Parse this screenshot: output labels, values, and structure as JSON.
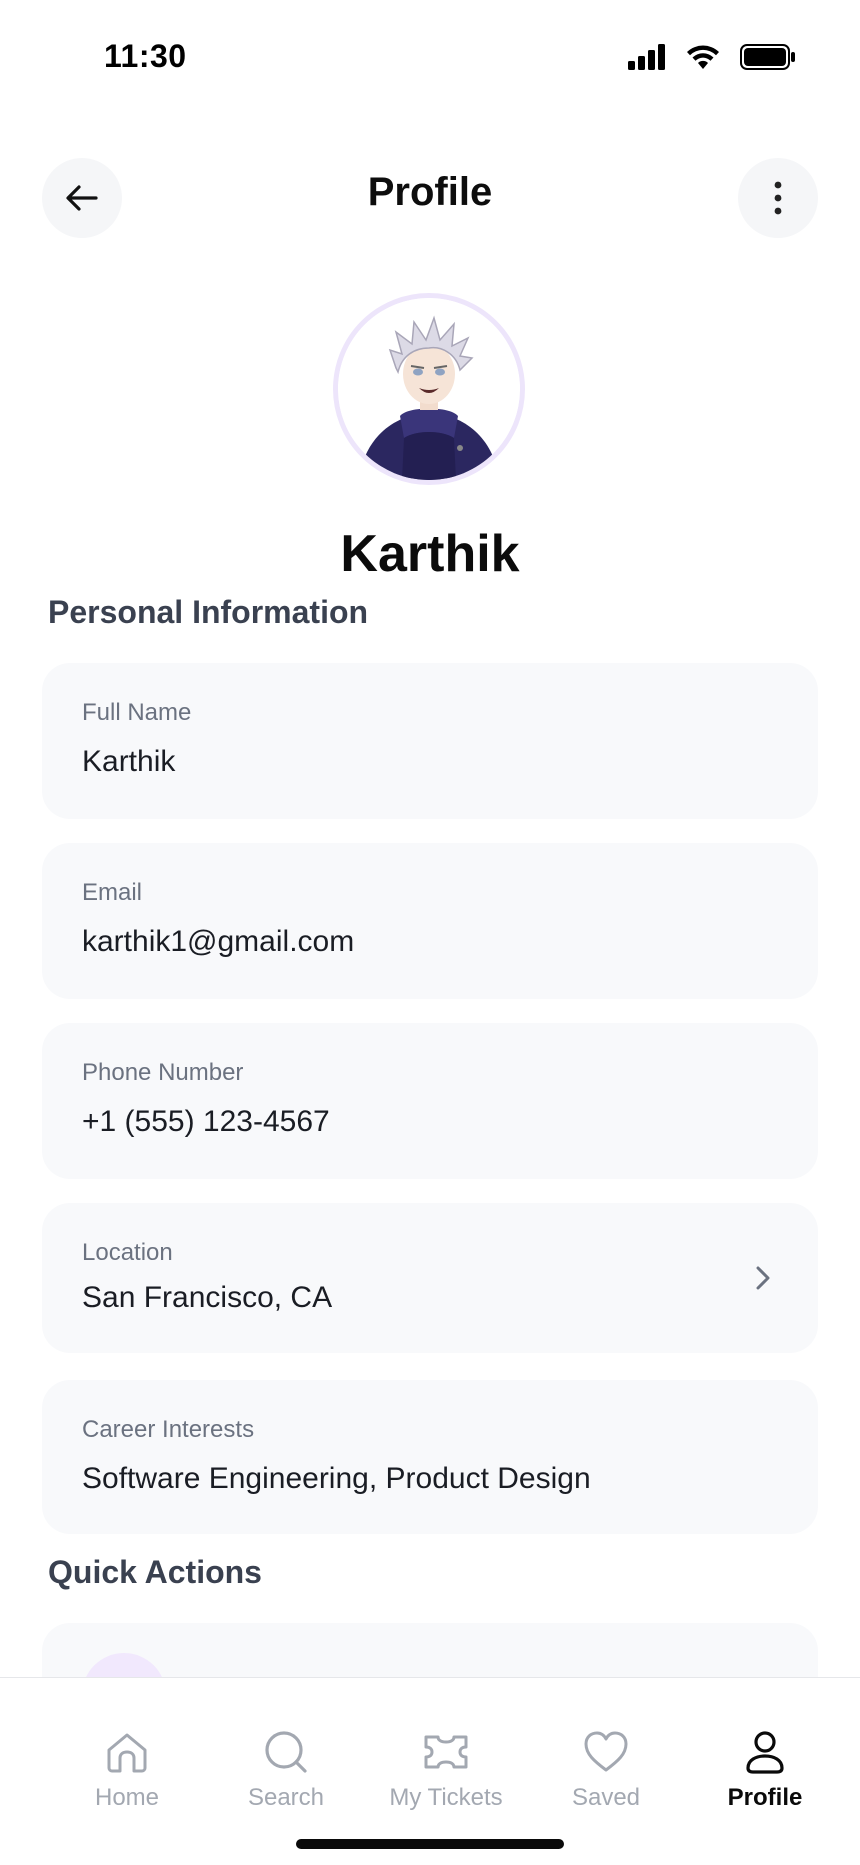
{
  "status_bar": {
    "time": "11:30",
    "icons": [
      "signal-icon",
      "wifi-icon",
      "battery-icon"
    ]
  },
  "header": {
    "title": "Profile",
    "back_icon": "arrow-left-icon",
    "more_icon": "more-vertical-icon"
  },
  "profile": {
    "name": "Karthik",
    "avatar": "anime-character-avatar"
  },
  "personal_info": {
    "section_title": "Personal Information",
    "fields": [
      {
        "label": "Full Name",
        "value": "Karthik"
      },
      {
        "label": "Email",
        "value": "karthik1@gmail.com"
      },
      {
        "label": "Phone Number",
        "value": "+1 (555) 123-4567"
      },
      {
        "label": "Location",
        "value": "San Francisco, CA"
      },
      {
        "label": "Career Interests",
        "value": "Software Engineering, Product Design"
      }
    ]
  },
  "quick_actions": {
    "section_title": "Quick Actions"
  },
  "tab_bar": {
    "tabs": [
      {
        "label": "Home",
        "icon": "home-icon",
        "active": false
      },
      {
        "label": "Search",
        "icon": "search-icon",
        "active": false
      },
      {
        "label": "My Tickets",
        "icon": "ticket-icon",
        "active": false
      },
      {
        "label": "Saved",
        "icon": "heart-icon",
        "active": false
      },
      {
        "label": "Profile",
        "icon": "user-icon",
        "active": true
      }
    ]
  },
  "colors": {
    "card_background": "#f8f9fb",
    "accent_avatar_ring": "#ede5fb",
    "tab_inactive": "#a3a8b1",
    "tab_active": "#0a0a0a"
  }
}
